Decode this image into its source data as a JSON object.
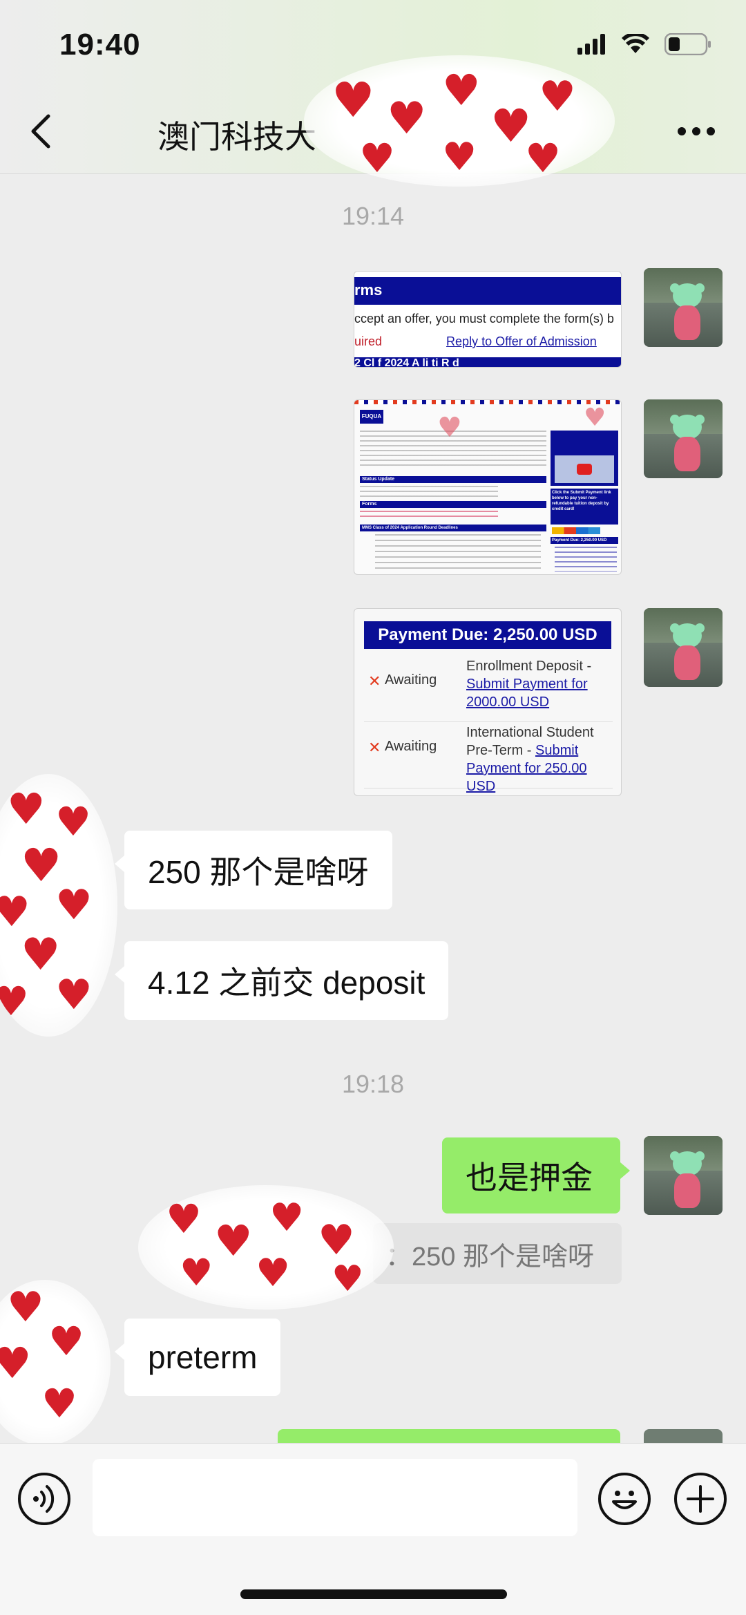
{
  "status_bar": {
    "time": "19:40"
  },
  "header": {
    "title": "澳门科技大"
  },
  "messages": {
    "time_1": "19:14",
    "image_1": {
      "heading": "rms",
      "line": "ccept an offer, you must complete the form(s) b",
      "required": "uired",
      "link": "Reply to Offer of Admission",
      "tail": "2 Cl    f 2024 A  li  ti   R    d"
    },
    "image_2": {
      "logo": "FUQUA",
      "status_heading": "Status Update",
      "forms_heading": "Forms",
      "deadlines_heading": "MMS Class of 2024 Application Round Deadlines",
      "cta": "Click the Submit Payment link below to pay your non-refundable tuition deposit by credit card!",
      "payment_due": "Payment Due: 2,250.00 USD"
    },
    "image_3": {
      "heading": "Payment Due: 2,250.00 USD",
      "rows": [
        {
          "status": "Awaiting",
          "desc": "Enrollment Deposit - ",
          "link": "Submit Payment for 2000.00 USD"
        },
        {
          "status": "Awaiting",
          "desc": "International Student Pre-Term - ",
          "link": "Submit Payment for 250.00 USD"
        }
      ]
    },
    "in_1": "250 那个是啥呀",
    "in_2": "4.12 之前交 deposit",
    "time_2": "19:18",
    "out_1": "也是押金",
    "quote_1": "：250 那个是啥呀",
    "in_3": "preterm"
  },
  "input": {
    "placeholder": ""
  },
  "colors": {
    "outgoing": "#95ec69",
    "incoming": "#ffffff",
    "background": "#ededed",
    "payment_header": "#0a0f96"
  },
  "icons": [
    "back-icon",
    "more-icon",
    "signal-icon",
    "wifi-icon",
    "battery-icon",
    "voice-icon",
    "emoji-icon",
    "plus-icon",
    "x-mark-icon"
  ]
}
